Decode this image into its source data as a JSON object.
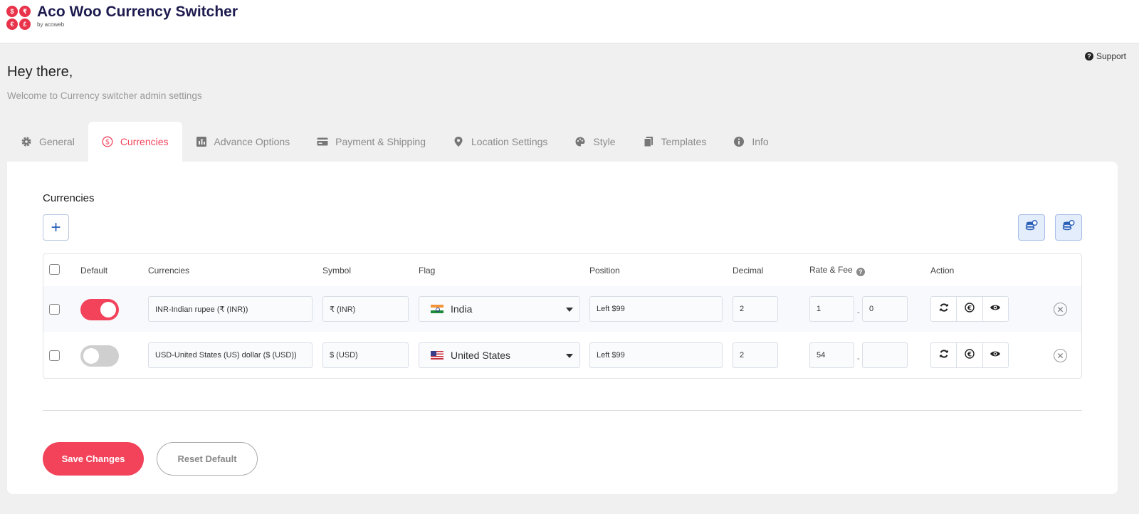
{
  "brand": {
    "title": "Aco Woo Currency Switcher",
    "subtitle": "by acoweb",
    "logo_glyphs": [
      "$",
      "₹",
      "€",
      "£"
    ],
    "accent_color": "#f2435b",
    "title_color": "#1d1b4f"
  },
  "header": {
    "support_label": "Support",
    "greeting": "Hey there,",
    "welcome": "Welcome to Currency switcher admin settings"
  },
  "tabs": [
    {
      "label": "General",
      "icon": "gear-icon",
      "active": false
    },
    {
      "label": "Currencies",
      "icon": "dollar-circle-icon",
      "active": true
    },
    {
      "label": "Advance Options",
      "icon": "advance-options-icon",
      "active": false
    },
    {
      "label": "Payment & Shipping",
      "icon": "credit-card-icon",
      "active": false
    },
    {
      "label": "Location Settings",
      "icon": "map-pin-icon",
      "active": false
    },
    {
      "label": "Style",
      "icon": "palette-icon",
      "active": false
    },
    {
      "label": "Templates",
      "icon": "templates-icon",
      "active": false
    },
    {
      "label": "Info",
      "icon": "info-icon",
      "active": false
    }
  ],
  "currencies_section": {
    "title": "Currencies",
    "add_button_label": "+",
    "columns": {
      "default": "Default",
      "currencies": "Currencies",
      "symbol": "Symbol",
      "flag": "Flag",
      "position": "Position",
      "decimal": "Decimal",
      "rate_fee": "Rate & Fee",
      "rate_fee_help": "?",
      "action": "Action"
    },
    "rows": [
      {
        "default": true,
        "currency": "INR-Indian rupee (₹ (INR))",
        "symbol": "₹ (INR)",
        "flag": "India",
        "position": "Left $99",
        "decimal": "2",
        "rate": "1",
        "fee": "0"
      },
      {
        "default": false,
        "currency": "USD-United States (US) dollar ($ (USD))",
        "symbol": "$ (USD)",
        "flag": "United States",
        "position": "Left $99",
        "decimal": "2",
        "rate": "54",
        "fee": ""
      }
    ]
  },
  "footer": {
    "save_label": "Save Changes",
    "reset_label": "Reset Default"
  }
}
